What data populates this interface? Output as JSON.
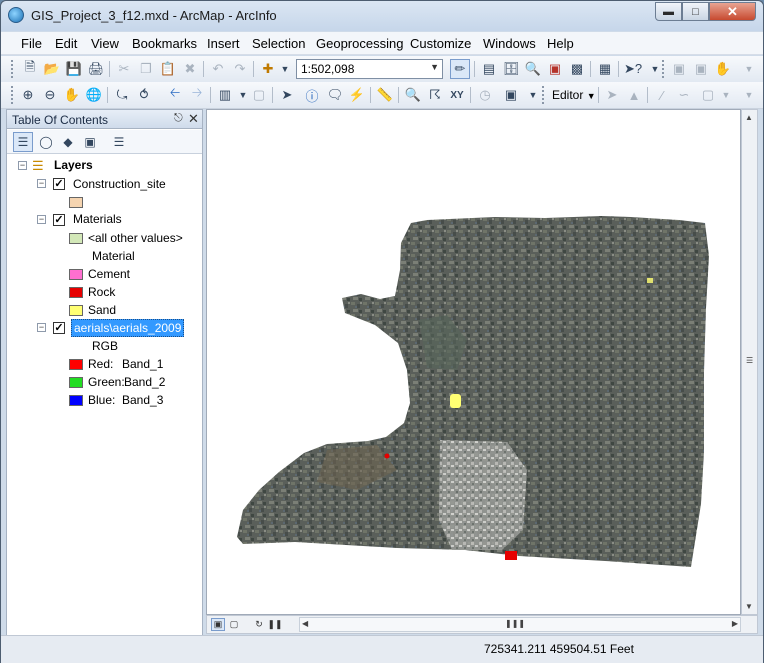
{
  "window": {
    "title": "GIS_Project_3_f12.mxd - ArcMap - ArcInfo",
    "minimize_icon": "minimize-icon",
    "maximize_icon": "maximize-icon",
    "close_icon": "close-icon"
  },
  "menu": {
    "items": [
      "File",
      "Edit",
      "View",
      "Bookmarks",
      "Insert",
      "Selection",
      "Geoprocessing",
      "Customize",
      "Windows",
      "Help"
    ]
  },
  "toolbar": {
    "scale_value": "1:502,098",
    "editor_label": "Editor"
  },
  "toc": {
    "title": "Table Of Contents",
    "root": "Layers",
    "layers": [
      {
        "name": "Construction_site",
        "checked": true
      },
      {
        "name": "Materials",
        "checked": true
      },
      {
        "name": "aerials\\aerials_2009",
        "checked": true
      }
    ],
    "materials_classes": [
      {
        "label": "<all other values>",
        "color": "#d3e8b8"
      },
      {
        "label": "Material",
        "color": ""
      },
      {
        "label": "Cement",
        "color": "#ff6fd0"
      },
      {
        "label": "Rock",
        "color": "#e60000"
      },
      {
        "label": "Sand",
        "color": "#ffff73"
      }
    ],
    "construction_color": "#f5d4b0",
    "aerials_legend": {
      "heading": "RGB",
      "bands": [
        {
          "label": "Red:",
          "band": "Band_1",
          "color": "#ff0000"
        },
        {
          "label": "Green:",
          "band": "Band_2",
          "color": "#22dd22"
        },
        {
          "label": "Blue:",
          "band": "Band_3",
          "color": "#0000ff"
        }
      ]
    }
  },
  "status": {
    "coordinates": "725341.211  459504.51 Feet"
  }
}
